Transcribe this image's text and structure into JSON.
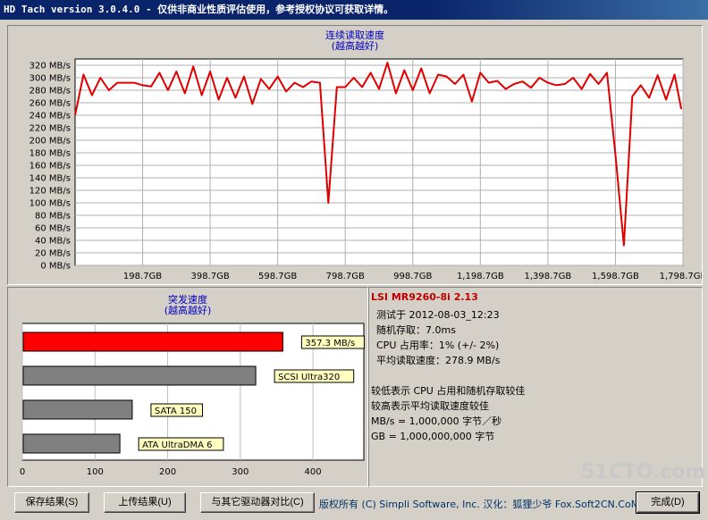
{
  "window": {
    "title": "HD Tach version 3.0.4.0  - 仅供非商业性质评估使用，参考授权协议可获取详情。"
  },
  "chart_data": [
    {
      "type": "line",
      "title": "连续读取速度",
      "subtitle": "(越高越好)",
      "y_ticks": [
        "320 MB/s",
        "300 MB/s",
        "280 MB/s",
        "260 MB/s",
        "240 MB/s",
        "220 MB/s",
        "200 MB/s",
        "180 MB/s",
        "160 MB/s",
        "140 MB/s",
        "120 MB/s",
        "100 MB/s",
        "80 MB/s",
        "60 MB/s",
        "40 MB/s",
        "20 MB/s",
        "0 MB/s"
      ],
      "x_ticks": [
        "198.7GB",
        "398.7GB",
        "598.7GB",
        "798.7GB",
        "998.7GB",
        "1,198.7GB",
        "1,398.7GB",
        "1,598.7GB",
        "1,798.7GB"
      ],
      "ylim": [
        0,
        330
      ],
      "xlim": [
        0,
        1800
      ],
      "grid": true,
      "series": [
        {
          "color": "#e00000",
          "x": [
            0,
            25,
            50,
            75,
            100,
            125,
            150,
            175,
            200,
            225,
            250,
            275,
            300,
            325,
            350,
            375,
            400,
            425,
            450,
            475,
            500,
            525,
            550,
            575,
            600,
            625,
            650,
            675,
            700,
            725,
            750,
            775,
            800,
            825,
            850,
            875,
            900,
            925,
            950,
            975,
            1000,
            1025,
            1050,
            1075,
            1100,
            1125,
            1150,
            1175,
            1200,
            1225,
            1250,
            1275,
            1300,
            1325,
            1350,
            1375,
            1400,
            1425,
            1450,
            1475,
            1500,
            1525,
            1550,
            1575,
            1600,
            1625,
            1650,
            1675,
            1700,
            1725,
            1750,
            1775,
            1795
          ],
          "y": [
            240,
            305,
            272,
            300,
            280,
            292,
            292,
            292,
            288,
            286,
            308,
            280,
            310,
            275,
            318,
            272,
            310,
            265,
            300,
            268,
            302,
            258,
            298,
            282,
            302,
            278,
            292,
            285,
            294,
            292,
            100,
            285,
            285,
            300,
            285,
            308,
            282,
            324,
            275,
            312,
            280,
            315,
            275,
            305,
            302,
            290,
            305,
            262,
            308,
            292,
            295,
            282,
            290,
            294,
            284,
            300,
            292,
            288,
            290,
            300,
            282,
            306,
            290,
            308,
            178,
            32,
            270,
            288,
            268,
            304,
            265,
            305,
            250
          ]
        }
      ]
    },
    {
      "type": "bar",
      "title": "突发速度",
      "subtitle": "(越高越好)",
      "x_ticks": [
        "0",
        "100",
        "200",
        "300",
        "400"
      ],
      "xlim": [
        0,
        470
      ],
      "orientation": "horizontal",
      "categories": [
        "357.3 MB/s",
        "SCSI Ultra320",
        "SATA 150",
        "ATA UltraDMA 6"
      ],
      "values": [
        357.3,
        320,
        150,
        133
      ],
      "colors": [
        "#ff0000",
        "#808080",
        "#808080",
        "#808080"
      ]
    }
  ],
  "info": {
    "device": "LSI MR9260-8i 2.13",
    "lines": [
      "测试于 2012-08-03_12:23",
      "随机存取：7.0ms",
      "CPU 占用率：1% (+/- 2%)",
      "平均读取速度：278.9 MB/s"
    ],
    "notes": [
      "较低表示 CPU 占用和随机存取较佳",
      "较高表示平均读取速度较佳",
      "MB/s = 1,000,000 字节／秒",
      "GB = 1,000,000,000 字节"
    ]
  },
  "buttons": {
    "save": "保存结果(S)",
    "upload": "上传结果(U)",
    "compare": "与其它驱动器对比(C)",
    "done": "完成(D)"
  },
  "copyright": "版权所有 (C) Simpli Software, Inc. 汉化：狐狸少爷 Fox.Soft2CN.CoM",
  "watermark": "51CTO.com"
}
